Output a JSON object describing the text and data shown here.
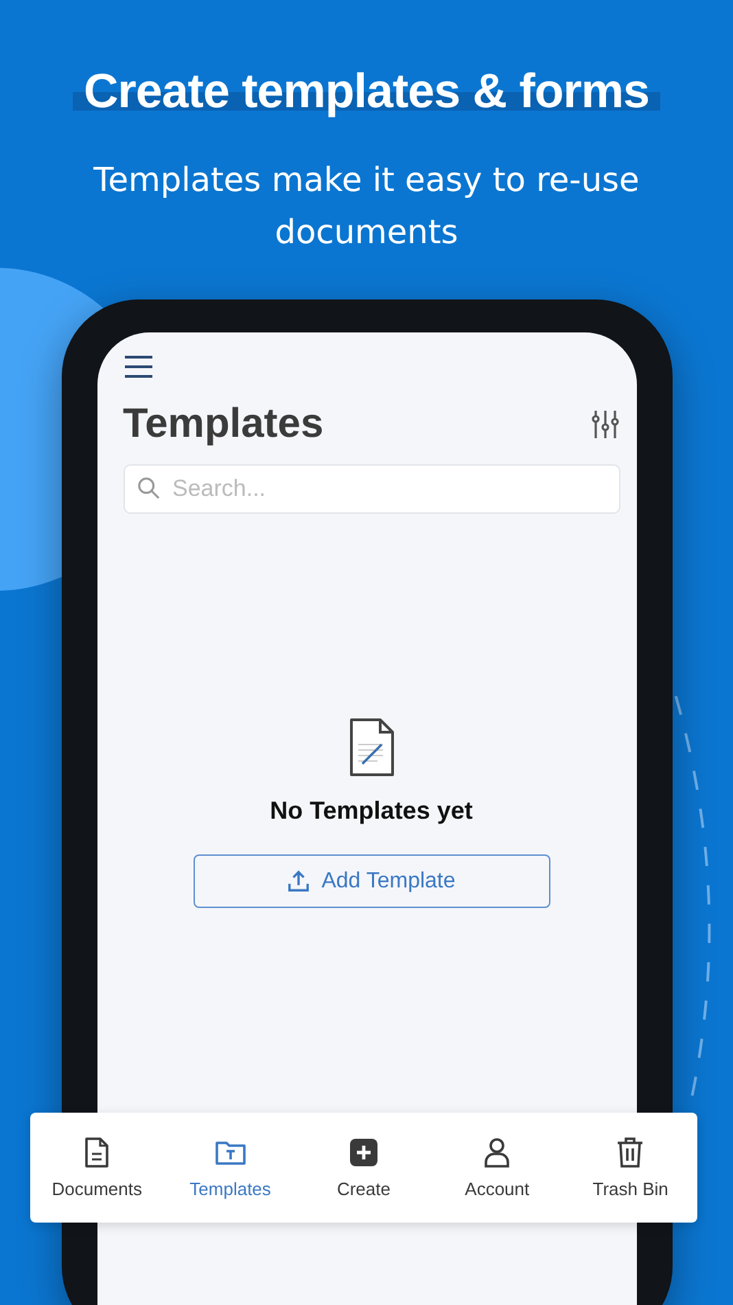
{
  "promo": {
    "headline": "Create templates & forms",
    "subtitle": "Templates make it easy to re-use documents"
  },
  "screen": {
    "title": "Templates",
    "search": {
      "placeholder": "Search..."
    },
    "empty_state": {
      "message": "No Templates yet",
      "button": "Add Template"
    }
  },
  "tab_bar": [
    {
      "label": "Documents",
      "selected": false
    },
    {
      "label": "Templates",
      "selected": true
    },
    {
      "label": "Create",
      "selected": false
    },
    {
      "label": "Account",
      "selected": false
    },
    {
      "label": "Trash Bin",
      "selected": false
    }
  ]
}
